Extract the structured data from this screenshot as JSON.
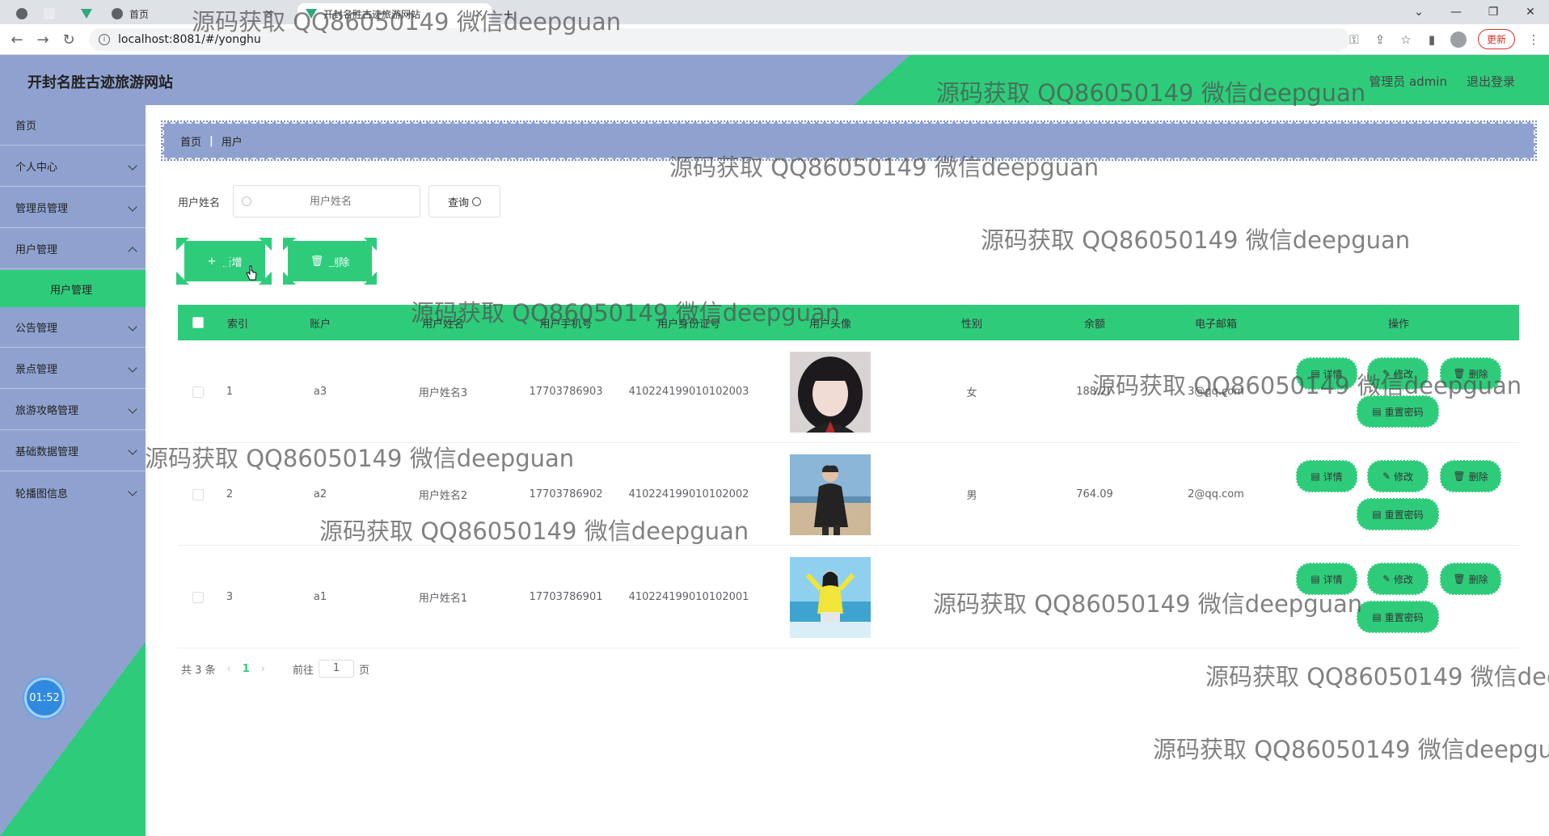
{
  "browser": {
    "tabs": [
      {
        "label": "首页"
      },
      {
        "label": "开封名胜古迹旅游网站"
      }
    ],
    "url": "localhost:8081/#/yonghu",
    "update_label": "更新"
  },
  "header": {
    "title": "开封名胜古迹旅游网站",
    "user": "管理员 admin",
    "logout": "退出登录"
  },
  "sidebar": {
    "items": [
      {
        "label": "首页"
      },
      {
        "label": "个人中心"
      },
      {
        "label": "管理员管理"
      },
      {
        "label": "用户管理"
      },
      {
        "label": "公告管理"
      },
      {
        "label": "景点管理"
      },
      {
        "label": "旅游攻略管理"
      },
      {
        "label": "基础数据管理"
      },
      {
        "label": "轮播图信息"
      }
    ],
    "subitem": "用户管理",
    "clock": "01:52"
  },
  "breadcrumb": {
    "home": "首页",
    "sep": "|",
    "current": "用户"
  },
  "search": {
    "label": "用户姓名",
    "placeholder": "用户姓名",
    "button": "查询"
  },
  "actions": {
    "add": "新增",
    "delete": "删除"
  },
  "table": {
    "headers": [
      "索引",
      "账户",
      "用户姓名",
      "用户手机号",
      "用户身份证号",
      "用户头像",
      "性别",
      "余额",
      "电子邮箱",
      "操作"
    ],
    "rows": [
      {
        "index": "1",
        "account": "a3",
        "name": "用户姓名3",
        "phone": "17703786903",
        "idcard": "410224199010102003",
        "gender": "女",
        "balance": "188.27",
        "email": "3@qq.com"
      },
      {
        "index": "2",
        "account": "a2",
        "name": "用户姓名2",
        "phone": "17703786902",
        "idcard": "410224199010102002",
        "gender": "男",
        "balance": "764.09",
        "email": "2@qq.com"
      },
      {
        "index": "3",
        "account": "a1",
        "name": "用户姓名1",
        "phone": "17703786901",
        "idcard": "410224199010102001",
        "gender": "",
        "balance": "",
        "email": ""
      }
    ],
    "ops": {
      "detail": "详情",
      "edit": "修改",
      "delete": "删除",
      "reset": "重置密码"
    }
  },
  "pager": {
    "total": "共 3 条",
    "page": "1",
    "goto": "前往",
    "goto_value": "1",
    "unit": "页"
  },
  "watermark": "源码获取 QQ86050149 微信deepguan",
  "colors": {
    "accent": "#2ecc7a",
    "sidebar": "#8fa2cf"
  }
}
